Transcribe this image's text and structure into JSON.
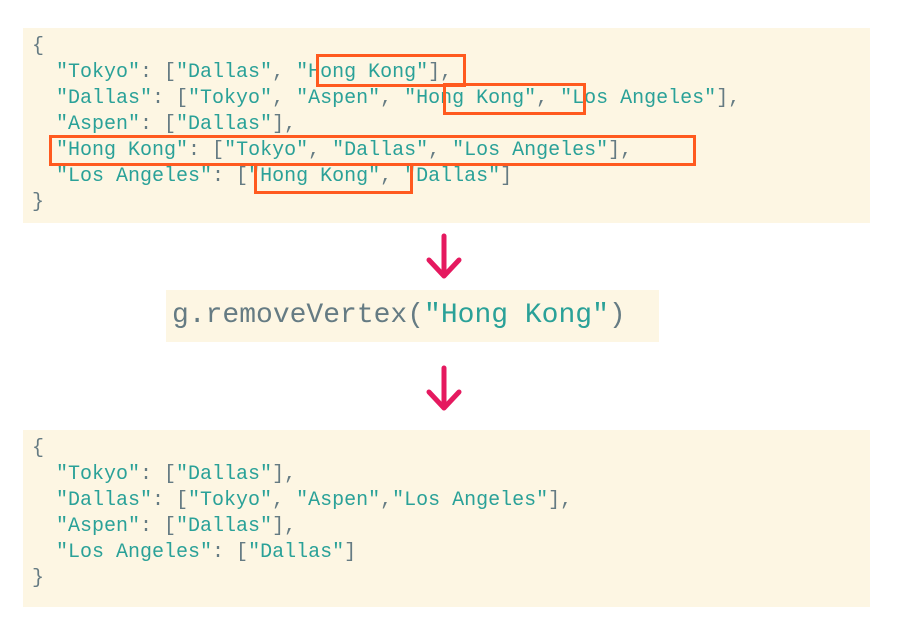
{
  "before": {
    "open_brace": "{",
    "close_brace": "}",
    "lines": [
      {
        "key": "\"Tokyo\"",
        "sep": ": [",
        "items": [
          "\"Dallas\"",
          ", ",
          "\"Hong Kong\""
        ],
        "end": "],"
      },
      {
        "key": "\"Dallas\"",
        "sep": ": [",
        "items": [
          "\"Tokyo\"",
          ", ",
          "\"Aspen\"",
          ", ",
          "\"Hong Kong\"",
          ", ",
          "\"Los Angeles\""
        ],
        "end": "],"
      },
      {
        "key": "\"Aspen\"",
        "sep": ": [",
        "items": [
          "\"Dallas\""
        ],
        "end": "],"
      },
      {
        "key": "\"Hong Kong\"",
        "sep": ": [",
        "items": [
          "\"Tokyo\"",
          ", ",
          "\"Dallas\"",
          ", ",
          "\"Los Angeles\""
        ],
        "end": "],"
      },
      {
        "key": "\"Los Angeles\"",
        "sep": ": [",
        "items": [
          "\"Hong Kong\"",
          ", ",
          "\"Dallas\""
        ],
        "end": "]"
      }
    ]
  },
  "operation": {
    "prefix": "g.removeVertex(",
    "arg": "\"Hong Kong\"",
    "suffix": ")"
  },
  "after": {
    "open_brace": "{",
    "close_brace": "}",
    "lines": [
      {
        "key": "\"Tokyo\"",
        "sep": ": [",
        "items": [
          "\"Dallas\""
        ],
        "end": "],"
      },
      {
        "key": "\"Dallas\"",
        "sep": ": [",
        "items": [
          "\"Tokyo\"",
          ", ",
          "\"Aspen\"",
          ",",
          "\"Los Angeles\""
        ],
        "end": "],"
      },
      {
        "key": "\"Aspen\"",
        "sep": ": [",
        "items": [
          "\"Dallas\""
        ],
        "end": "],"
      },
      {
        "key": "\"Los Angeles\"",
        "sep": ": [",
        "items": [
          "\"Dallas\""
        ],
        "end": "]"
      }
    ]
  },
  "colors": {
    "highlight": "#ff5a1f",
    "arrow": "#e5195f",
    "string": "#2aa198",
    "punctuation": "#657b83",
    "code_background": "#fdf6e3"
  },
  "icons": {
    "arrow": "arrow-down-icon"
  }
}
